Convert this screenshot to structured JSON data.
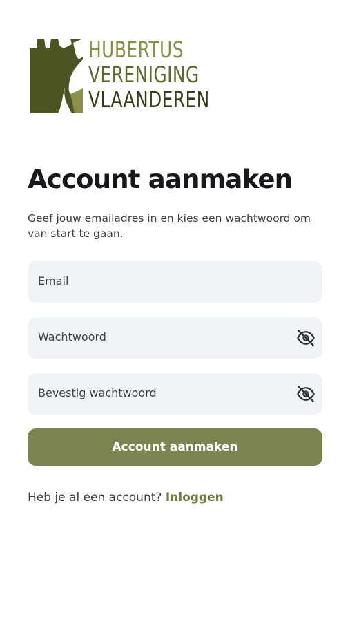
{
  "brand": {
    "logo_lines": [
      "HUBERTUS",
      "VERENIGING",
      "VLAANDEREN"
    ],
    "logo_colors": {
      "line1": "#8a9047",
      "line2": "#5d6a2c",
      "line3": "#343e19",
      "mark_dark": "#4a5523",
      "mark_light": "#8a9047"
    }
  },
  "page": {
    "heading": "Account aanmaken",
    "subtitle": "Geef jouw emailadres in en kies een wachtwoord om van start te gaan."
  },
  "form": {
    "email": {
      "placeholder": "Email",
      "value": ""
    },
    "password": {
      "placeholder": "Wachtwoord",
      "value": "",
      "toggle_icon": "eye-off-icon"
    },
    "confirm_password": {
      "placeholder": "Bevestig wachtwoord",
      "value": "",
      "toggle_icon": "eye-off-icon"
    },
    "submit_label": "Account aanmaken"
  },
  "footer": {
    "prompt": "Heb je al een account?",
    "link_label": "Inloggen"
  },
  "colors": {
    "accent": "#7a8450",
    "link": "#6f7a3c",
    "field_bg": "#f0f3f6",
    "heading": "#16181b",
    "text": "#3b4046"
  }
}
